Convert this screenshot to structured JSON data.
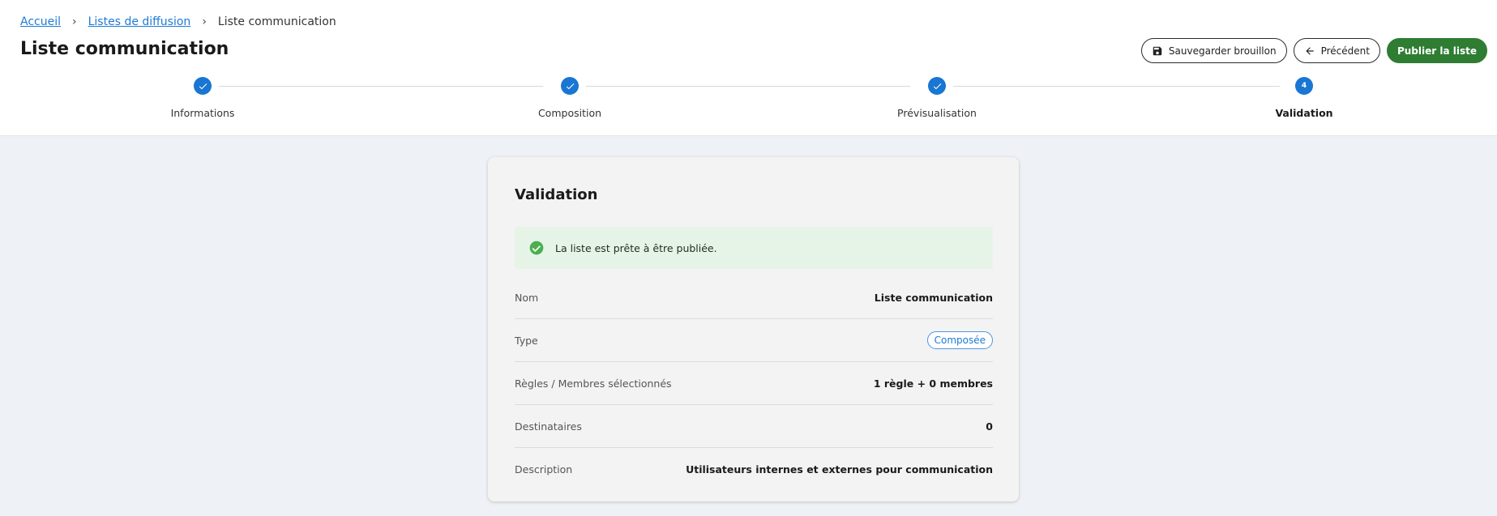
{
  "breadcrumb": {
    "items": [
      "Accueil",
      "Listes de diffusion"
    ],
    "current": "Liste communication"
  },
  "header": {
    "title": "Liste communication",
    "save_draft_label": "Sauvegarder brouillon",
    "previous_label": "Précédent",
    "publish_label": "Publier la liste"
  },
  "stepper": {
    "steps": [
      {
        "label": "Informations",
        "state": "completed"
      },
      {
        "label": "Composition",
        "state": "completed"
      },
      {
        "label": "Prévisualisation",
        "state": "completed"
      },
      {
        "label": "Validation",
        "state": "active",
        "number": "4"
      }
    ]
  },
  "card": {
    "title": "Validation",
    "alert": "La liste est prête à être publiée.",
    "rows": [
      {
        "label": "Nom",
        "value": "Liste communication"
      },
      {
        "label": "Type",
        "value": "Composée"
      },
      {
        "label": "Règles / Membres sélectionnés",
        "value": "1 règle + 0 membres"
      },
      {
        "label": "Destinataires",
        "value": "0"
      },
      {
        "label": "Description",
        "value": "Utilisateurs internes et externes pour communication"
      }
    ]
  },
  "colors": {
    "accent": "#1976d2",
    "success": "#2e7d32",
    "success_bg": "#e6f4e7",
    "link": "#1e7ad6",
    "page_bg": "#eef1f5"
  },
  "icons": {
    "save": "floppy-disk-icon",
    "previous": "arrow-left-icon",
    "step_done": "check-icon",
    "alert": "check-circle-icon"
  }
}
